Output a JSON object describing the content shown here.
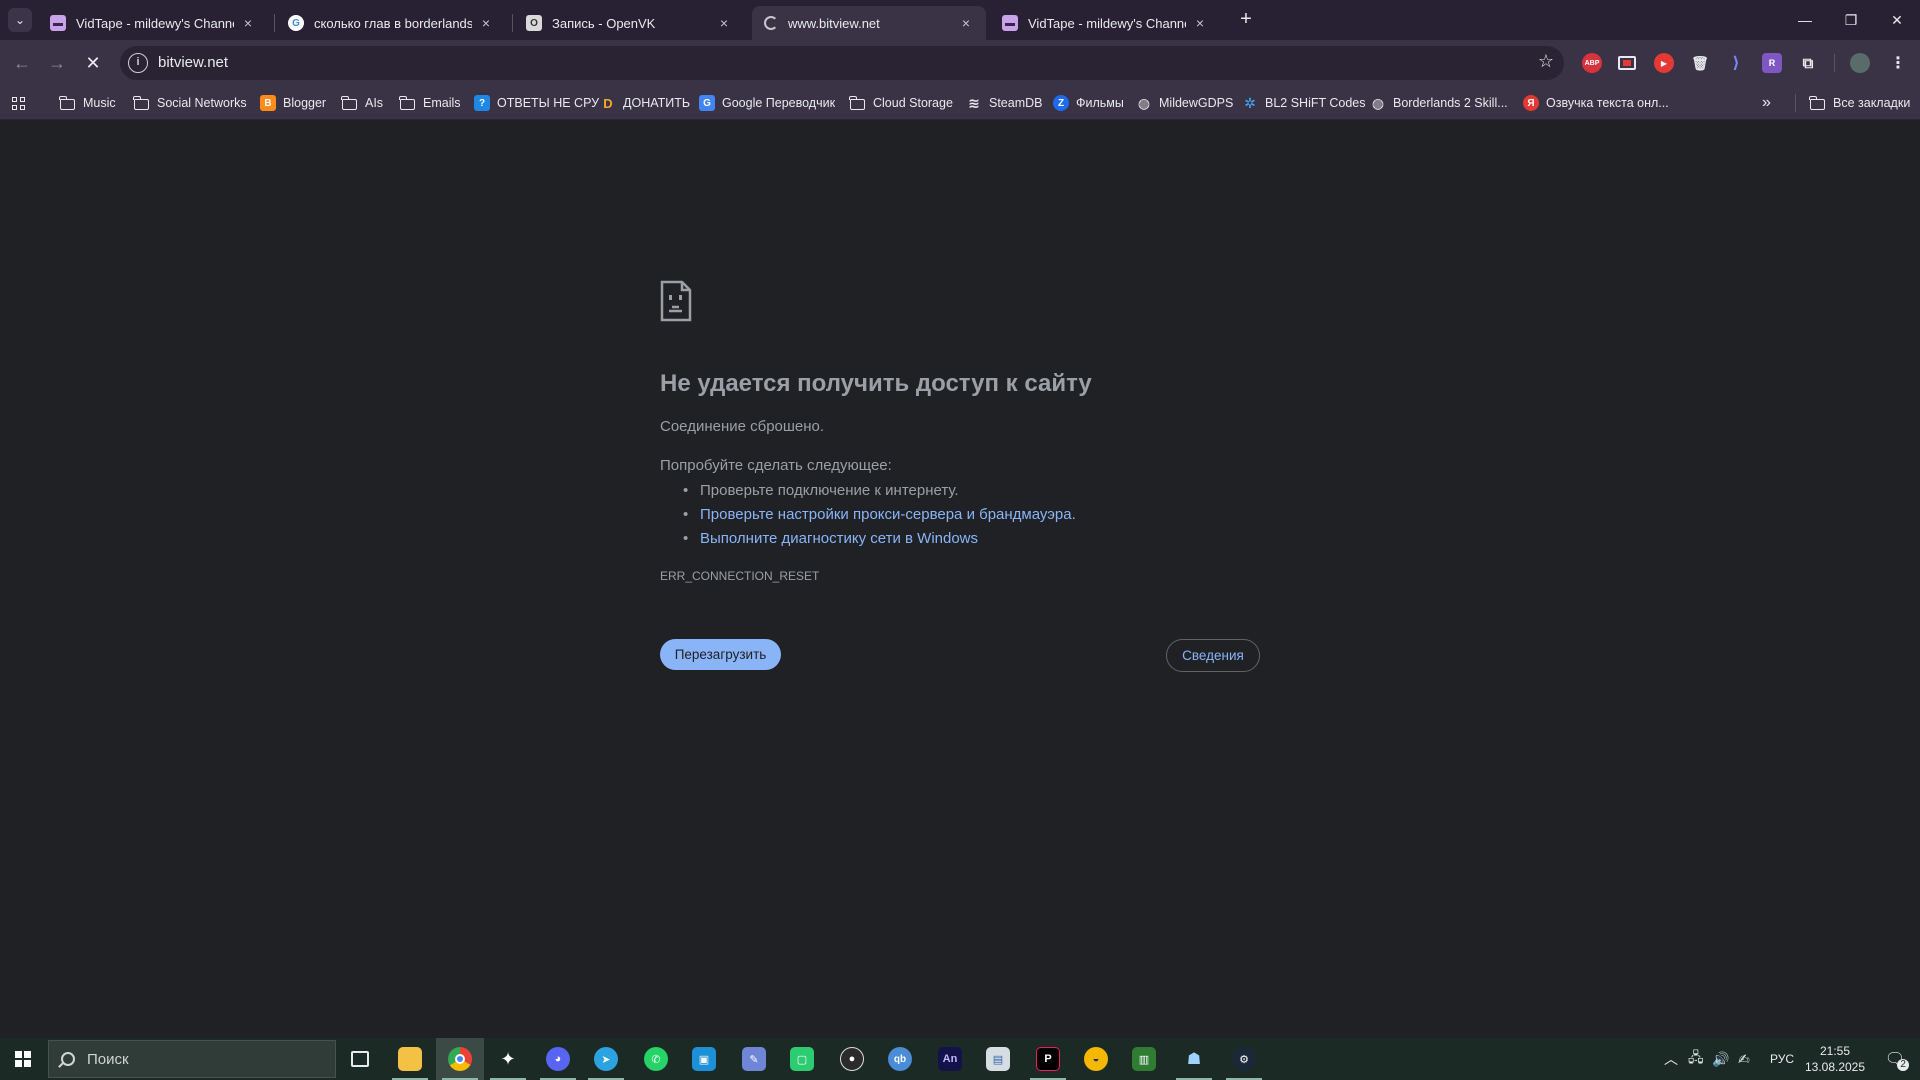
{
  "tabs": [
    {
      "title": "VidTape - mildewy's Channel",
      "favicon": "vidtape-icon",
      "active": false
    },
    {
      "title": "сколько глав в borderlands the",
      "favicon": "google-icon",
      "active": false
    },
    {
      "title": "Запись - OpenVK",
      "favicon": "openvk-icon",
      "active": false
    },
    {
      "title": "www.bitview.net",
      "favicon": "loading-spinner-icon",
      "active": true
    },
    {
      "title": "VidTape - mildewy's Channel",
      "favicon": "vidtape-icon",
      "active": false
    }
  ],
  "tab_close_glyph": "×",
  "new_tab_glyph": "+",
  "window_controls": {
    "minimize": "—",
    "maximize": "❐",
    "close": "✕"
  },
  "address_bar": {
    "url": "bitview.net"
  },
  "extensions": [
    "adblock-plus-icon",
    "cast-icon",
    "youtube-icon",
    "trash-icon",
    "terminal-icon",
    "r-extension-icon",
    "extensions-puzzle-icon",
    "profile-avatar-icon"
  ],
  "bookmarks": [
    {
      "label": "Music",
      "type": "folder"
    },
    {
      "label": "Social Networks",
      "type": "folder"
    },
    {
      "label": "Blogger",
      "type": "site",
      "icon": "blogger-icon"
    },
    {
      "label": "AIs",
      "type": "folder"
    },
    {
      "label": "Emails",
      "type": "folder"
    },
    {
      "label": "ОТВЕТЫ НЕ СРУ",
      "type": "site",
      "icon": "question-icon"
    },
    {
      "label": "ДОНАТИТЬ",
      "type": "site",
      "icon": "donationalerts-icon"
    },
    {
      "label": "Google Переводчик",
      "type": "site",
      "icon": "google-translate-icon"
    },
    {
      "label": "Cloud Storage",
      "type": "folder"
    },
    {
      "label": "SteamDB",
      "type": "site",
      "icon": "steamdb-icon"
    },
    {
      "label": "Фильмы",
      "type": "site",
      "icon": "z-icon"
    },
    {
      "label": "MildewGDPS",
      "type": "site",
      "icon": "globe-icon"
    },
    {
      "label": "BL2 SHiFT Codes",
      "type": "site",
      "icon": "gear-site-icon"
    },
    {
      "label": "Borderlands 2 Skill...",
      "type": "site",
      "icon": "globe-icon"
    },
    {
      "label": "Озвучка текста онл...",
      "type": "site",
      "icon": "yandex-icon"
    }
  ],
  "bookmarks_overflow": "»",
  "all_bookmarks": "Все закладки",
  "error": {
    "title": "Не удается получить доступ к сайту",
    "subtitle": "Соединение сброшено.",
    "try_heading": "Попробуйте сделать следующее:",
    "suggestions": [
      "Проверьте подключение к интернету.",
      "Проверьте настройки прокси-сервера и брандмауэра.",
      "Выполните диагностику сети в Windows"
    ],
    "code": "ERR_CONNECTION_RESET",
    "reload_button": "Перезагрузить",
    "details_button": "Сведения"
  },
  "taskbar": {
    "search_placeholder": "Поиск",
    "apps": [
      "task-view-icon",
      "file-explorer-icon",
      "chrome-icon",
      "fox-app-icon",
      "discord-icon",
      "telegram-icon",
      "whatsapp-icon",
      "remote-app-icon",
      "paint-app-icon",
      "green-app-icon",
      "obs-icon",
      "qbittorrent-icon",
      "animate-icon",
      "notepad-app-icon",
      "jetbrains-icon",
      "yellow-app-icon",
      "chart-app-icon",
      "network-app-icon",
      "steam-icon"
    ],
    "tray_language": "РУС",
    "time": "21:55",
    "date": "13.08.2025",
    "notifications": "2"
  },
  "colors": {
    "accent": "#8ab4f8",
    "tab_bar": "#282134",
    "toolbar": "#3a3346",
    "page_bg": "#202124",
    "taskbar": "#1c2a26"
  }
}
